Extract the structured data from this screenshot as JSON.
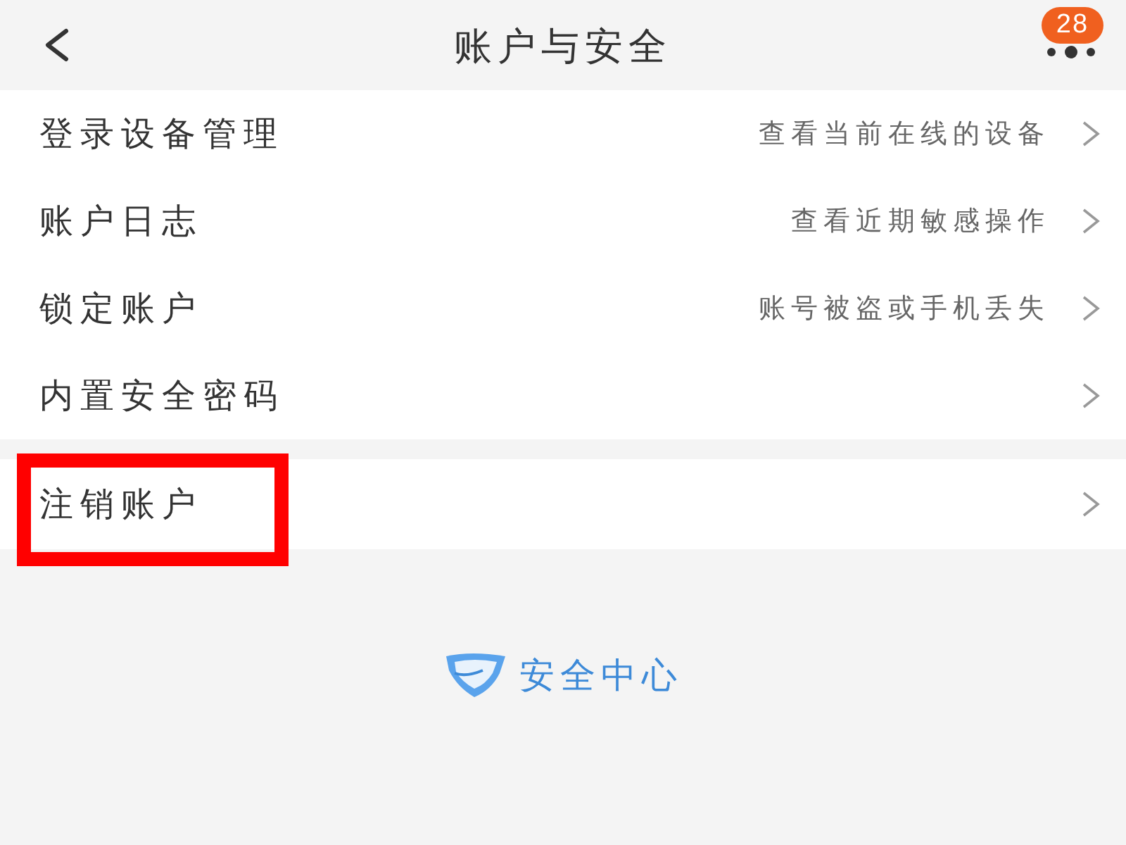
{
  "header": {
    "title": "账户与安全",
    "badge": "28"
  },
  "groups": [
    {
      "items": [
        {
          "label": "登录设备管理",
          "hint": "查看当前在线的设备",
          "highlighted": false
        },
        {
          "label": "账户日志",
          "hint": "查看近期敏感操作",
          "highlighted": false
        },
        {
          "label": "锁定账户",
          "hint": "账号被盗或手机丢失",
          "highlighted": false
        },
        {
          "label": "内置安全密码",
          "highlighted": false
        }
      ]
    },
    {
      "items": [
        {
          "label": "注销账户",
          "highlighted": true
        }
      ]
    }
  ],
  "footer": {
    "label": "安全中心"
  }
}
